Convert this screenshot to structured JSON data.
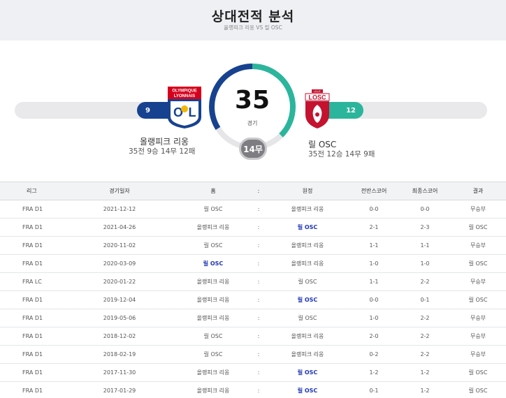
{
  "header": {
    "title": "상대전적 분석",
    "subtitle": "올랭피크 리옹 VS 릴 OSC"
  },
  "summary": {
    "total_games": "35",
    "games_label": "경기",
    "draws_label": "14무",
    "home": {
      "name": "올랭피크 리옹",
      "record": "35전 9승 14무 12패",
      "wins": "9",
      "color": "#17428f",
      "logo_text_1": "OLYMPIQUE",
      "logo_text_2": "LYONNAIS"
    },
    "away": {
      "name": "릴 OSC",
      "record": "35전 12승 14무 9패",
      "wins": "12",
      "color": "#2bb59c",
      "logo_text_1": "LILLE",
      "logo_text_2": "LOSC"
    },
    "draw_color": "#7d7d82"
  },
  "table": {
    "headers": [
      "리그",
      "경기일자",
      "홈",
      ":",
      "원정",
      "전반스코어",
      "최종스코어",
      "결과"
    ],
    "rows": [
      {
        "league": "FRA D1",
        "date": "2021-12-12",
        "home": "릴 OSC",
        "sep": ":",
        "away": "올랭피크 리옹",
        "half": "0-0",
        "final": "0-0",
        "result": "무승부",
        "winner": "none"
      },
      {
        "league": "FRA D1",
        "date": "2021-04-26",
        "home": "올랭피크 리옹",
        "sep": ":",
        "away": "릴 OSC",
        "half": "2-1",
        "final": "2-3",
        "result": "릴 OSC",
        "winner": "away"
      },
      {
        "league": "FRA D1",
        "date": "2020-11-02",
        "home": "릴 OSC",
        "sep": ":",
        "away": "올랭피크 리옹",
        "half": "1-1",
        "final": "1-1",
        "result": "무승부",
        "winner": "none"
      },
      {
        "league": "FRA D1",
        "date": "2020-03-09",
        "home": "릴 OSC",
        "sep": ":",
        "away": "올랭피크 리옹",
        "half": "1-0",
        "final": "1-0",
        "result": "릴 OSC",
        "winner": "home"
      },
      {
        "league": "FRA LC",
        "date": "2020-01-22",
        "home": "올랭피크 리옹",
        "sep": ":",
        "away": "릴 OSC",
        "half": "1-1",
        "final": "2-2",
        "result": "무승부",
        "winner": "none"
      },
      {
        "league": "FRA D1",
        "date": "2019-12-04",
        "home": "올랭피크 리옹",
        "sep": ":",
        "away": "릴 OSC",
        "half": "0-0",
        "final": "0-1",
        "result": "릴 OSC",
        "winner": "away"
      },
      {
        "league": "FRA D1",
        "date": "2019-05-06",
        "home": "올랭피크 리옹",
        "sep": ":",
        "away": "릴 OSC",
        "half": "1-0",
        "final": "2-2",
        "result": "무승부",
        "winner": "none"
      },
      {
        "league": "FRA D1",
        "date": "2018-12-02",
        "home": "릴 OSC",
        "sep": ":",
        "away": "올랭피크 리옹",
        "half": "2-0",
        "final": "2-2",
        "result": "무승부",
        "winner": "none"
      },
      {
        "league": "FRA D1",
        "date": "2018-02-19",
        "home": "릴 OSC",
        "sep": ":",
        "away": "올랭피크 리옹",
        "half": "0-2",
        "final": "2-2",
        "result": "무승부",
        "winner": "none"
      },
      {
        "league": "FRA D1",
        "date": "2017-11-30",
        "home": "올랭피크 리옹",
        "sep": ":",
        "away": "릴 OSC",
        "half": "1-2",
        "final": "1-2",
        "result": "릴 OSC",
        "winner": "away"
      },
      {
        "league": "FRA D1",
        "date": "2017-01-29",
        "home": "올랭피크 리옹",
        "sep": ":",
        "away": "릴 OSC",
        "half": "0-1",
        "final": "1-2",
        "result": "릴 OSC",
        "winner": "away"
      }
    ]
  }
}
